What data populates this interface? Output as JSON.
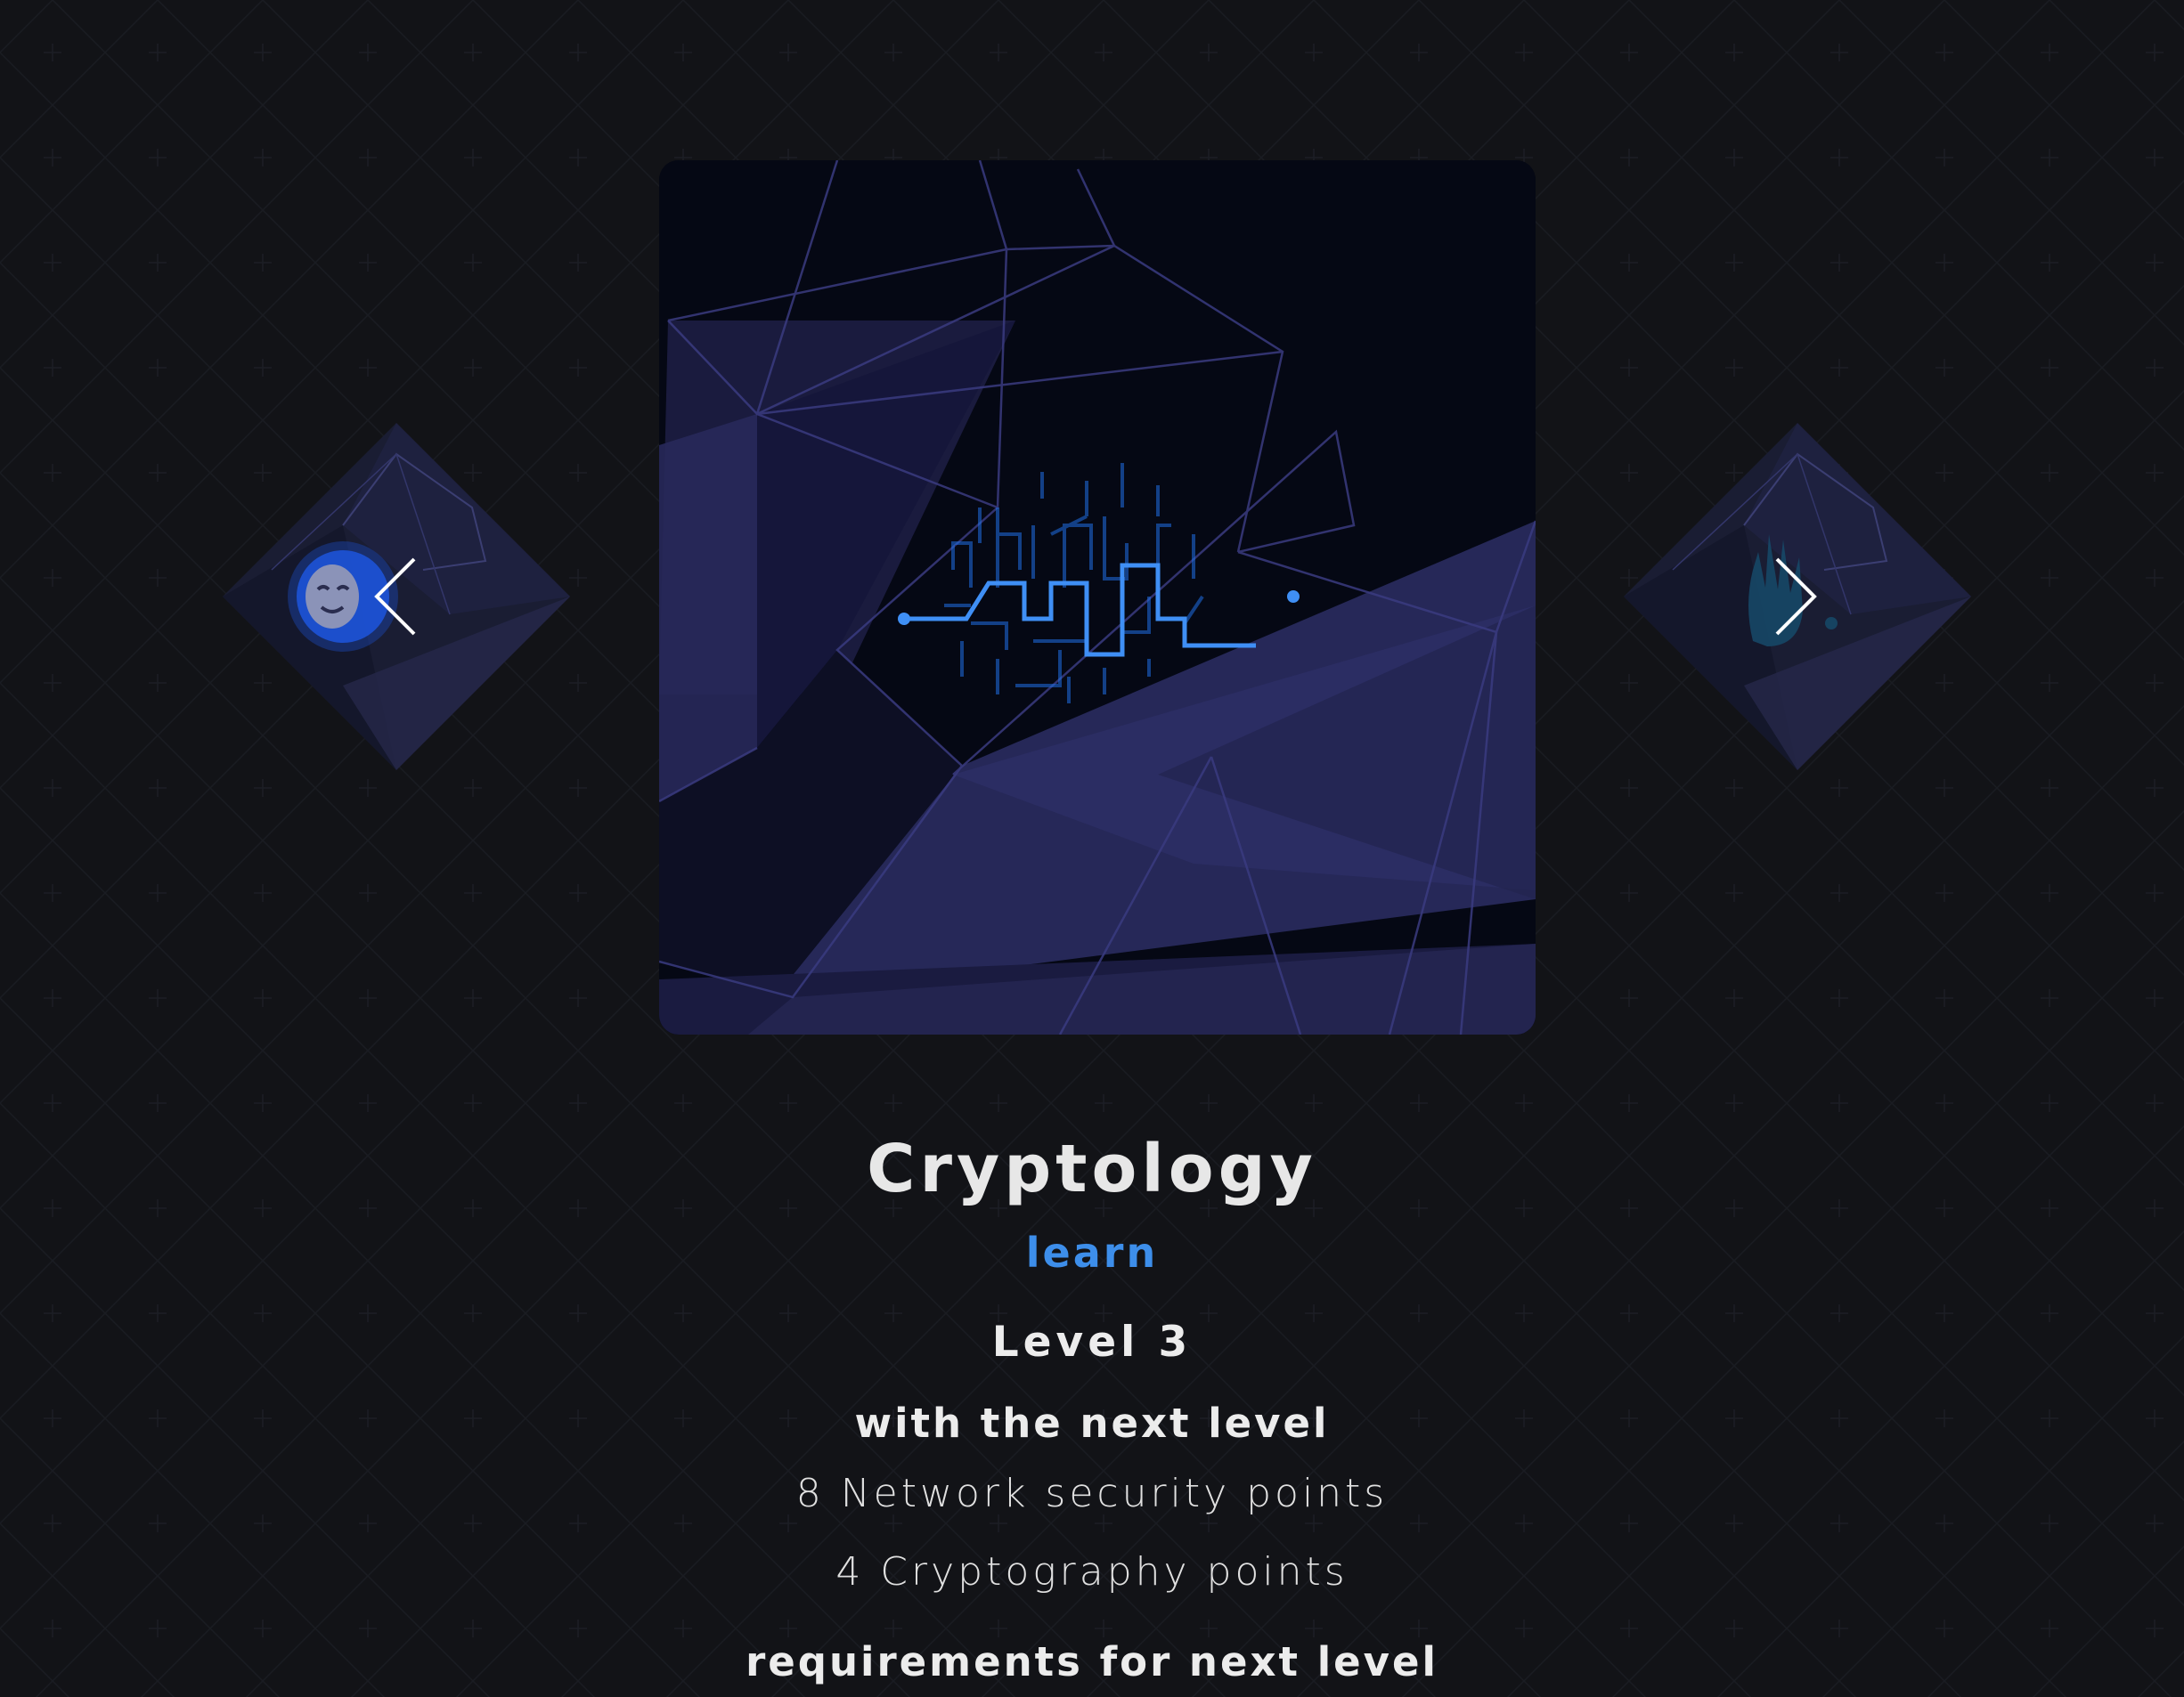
{
  "skill": {
    "title": "Cryptology",
    "learn_label": "learn",
    "level": "Level 3",
    "next_level_heading": "with the next level",
    "next_level_points": [
      "8 Network security points",
      "4 Cryptography points"
    ],
    "requirements_heading": "requirements for next level"
  },
  "carousel": {
    "main_image": "cryptology-circuit-illustration",
    "prev_image": "theater-masks-illustration",
    "next_image": "handprint-illustration",
    "prev_arrow_icon": "chevron-left-icon",
    "next_arrow_icon": "chevron-right-icon"
  },
  "colors": {
    "background": "#121317",
    "accent": "#3d8eea",
    "text": "#e7e7e7",
    "panel": "#050814",
    "polygon": "#25264f"
  }
}
